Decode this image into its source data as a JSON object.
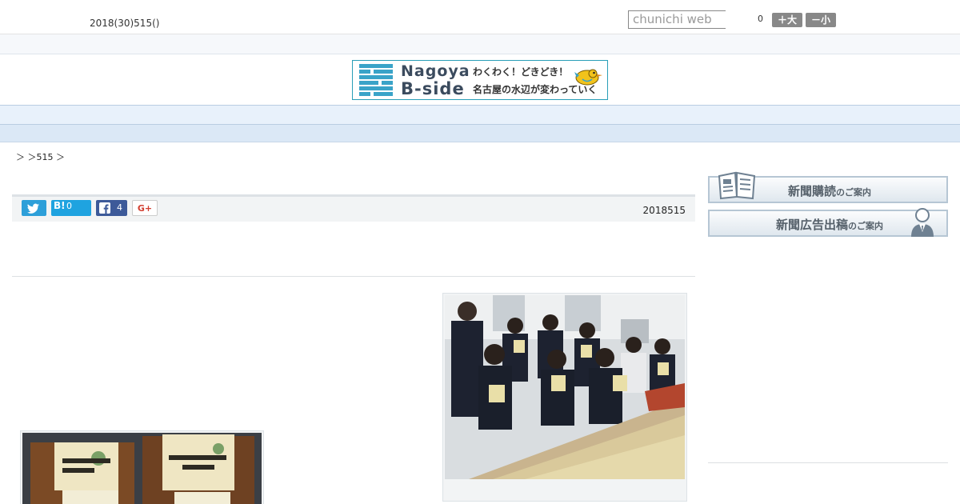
{
  "header": {
    "date": "2018(30)515()",
    "search_placeholder": "chunichi web",
    "font_size_count": "0",
    "font_large_label": "＋大",
    "font_small_label": "－小"
  },
  "logo": {
    "name_line1": "Nagoya",
    "name_line2": "B-side",
    "tagline1": "わくわく！どきどき！",
    "tagline2": "名古屋の水辺が変わっていく"
  },
  "nav": {
    "items": [
      "",
      "",
      "",
      "",
      "",
      "",
      "",
      "",
      ""
    ]
  },
  "breadcrumb": {
    "text": "＞ ＞515 ＞"
  },
  "share": {
    "twitter_icon": "twitter-bird-icon",
    "hatena_label": "B!",
    "hatena_count": "0",
    "facebook_count": "4",
    "gplus_label": "G+",
    "published_date": "2018515"
  },
  "sidebar": {
    "subscribe_main": "新聞購読",
    "subscribe_suffix": "のご案内",
    "advertise_main": "新聞広告出稿",
    "advertise_suffix": "のご案内"
  },
  "colors": {
    "nav_bg": "#e8f1fb",
    "twitter": "#2d9fd9",
    "hatena": "#1fa3e0",
    "facebook": "#3d5a99",
    "logo_blue": "#3aa3c8"
  }
}
